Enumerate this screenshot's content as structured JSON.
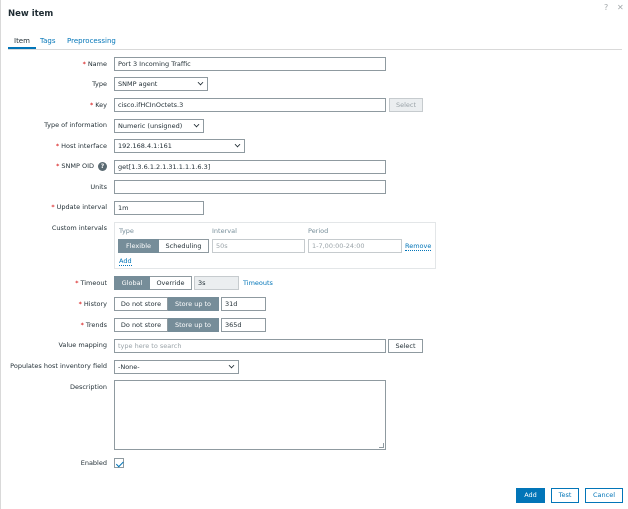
{
  "dialog": {
    "title": "New item",
    "help_glyph": "?",
    "close_glyph": "✕"
  },
  "tabs": [
    {
      "label": "Item",
      "active": true
    },
    {
      "label": "Tags"
    },
    {
      "label": "Preprocessing"
    }
  ],
  "required_marker": "*",
  "fields": {
    "name": {
      "label": "Name",
      "value": "Port 3 Incoming Traffic"
    },
    "type": {
      "label": "Type",
      "value": "SNMP agent"
    },
    "key": {
      "label": "Key",
      "value": "cisco.ifHCInOctets.3",
      "select_label": "Select"
    },
    "type_of_information": {
      "label": "Type of information",
      "value": "Numeric (unsigned)"
    },
    "host_interface": {
      "label": "Host interface",
      "value": "192.168.4.1:161"
    },
    "snmp_oid": {
      "label": "SNMP OID",
      "value": "get[1.3.6.1.2.1.31.1.1.1.6.3]",
      "help_glyph": "?"
    },
    "units": {
      "label": "Units",
      "value": ""
    },
    "update_interval": {
      "label": "Update interval",
      "value": "1m"
    },
    "custom_intervals": {
      "label": "Custom intervals",
      "headers": {
        "type": "Type",
        "interval": "Interval",
        "period": "Period"
      },
      "type_options": [
        "Flexible",
        "Scheduling"
      ],
      "selected_type": "Flexible",
      "interval_placeholder": "50s",
      "period_placeholder": "1-7,00:00-24:00",
      "remove_label": "Remove",
      "add_label": "Add"
    },
    "timeout": {
      "label": "Timeout",
      "options": [
        "Global",
        "Override"
      ],
      "selected": "Global",
      "value": "3s",
      "link_label": "Timeouts"
    },
    "history": {
      "label": "History",
      "options": [
        "Do not store",
        "Store up to"
      ],
      "selected": "Store up to",
      "value": "31d"
    },
    "trends": {
      "label": "Trends",
      "options": [
        "Do not store",
        "Store up to"
      ],
      "selected": "Store up to",
      "value": "365d"
    },
    "value_mapping": {
      "label": "Value mapping",
      "placeholder": "type here to search",
      "select_label": "Select"
    },
    "inventory_field": {
      "label": "Populates host inventory field",
      "value": "-None-"
    },
    "description": {
      "label": "Description",
      "value": ""
    },
    "enabled": {
      "label": "Enabled",
      "checked": true
    }
  },
  "footer": {
    "add": "Add",
    "test": "Test",
    "cancel": "Cancel"
  },
  "colors": {
    "accent": "#0275b8",
    "toggle_on": "#768d99",
    "required": "#d40000"
  }
}
